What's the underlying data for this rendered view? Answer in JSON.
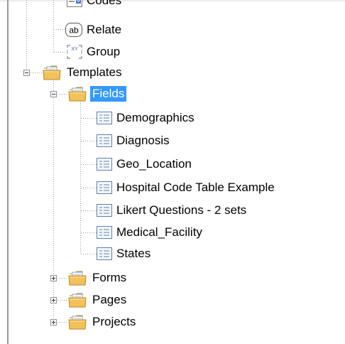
{
  "tree": {
    "codes_label": "Codes",
    "relate_label": "Relate",
    "relate_icon_text": "ab",
    "group_label": "Group",
    "group_icon_text": "XY",
    "templates_label": "Templates",
    "fields_label": "Fields",
    "field_items": [
      {
        "label": "Demographics"
      },
      {
        "label": "Diagnosis"
      },
      {
        "label": "Geo_Location"
      },
      {
        "label": "Hospital Code Table Example"
      },
      {
        "label": "Likert Questions - 2 sets"
      },
      {
        "label": "Medical_Facility"
      },
      {
        "label": "States"
      }
    ],
    "forms_label": "Forms",
    "pages_label": "Pages",
    "projects_label": "Projects"
  },
  "colors": {
    "selection": "#3399ff",
    "folder": "#f3c15a",
    "tree_lines": "#a0a0a0"
  }
}
